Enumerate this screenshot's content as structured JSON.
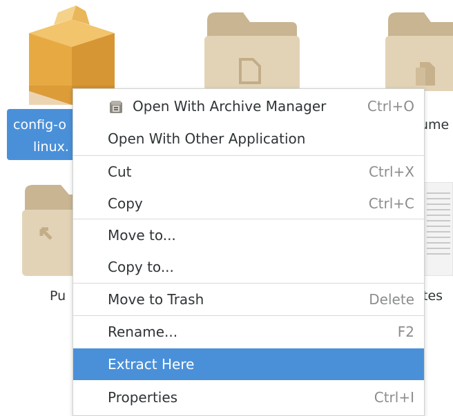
{
  "desktop": {
    "items": [
      {
        "name": "selected-item",
        "label_line1": "config-o",
        "label_line2": "linux."
      },
      {
        "name": "documents-folder",
        "label_partial": "ume"
      },
      {
        "name": "public-folder",
        "label_partial": "Pu"
      },
      {
        "name": "templates-folder",
        "label_partial": "tes"
      }
    ]
  },
  "context_menu": {
    "items": [
      {
        "label": "Open With Archive Manager",
        "shortcut": "Ctrl+O",
        "icon": "archive-manager-icon"
      },
      {
        "label": "Open With Other Application",
        "shortcut": ""
      },
      {
        "label": "Cut",
        "shortcut": "Ctrl+X"
      },
      {
        "label": "Copy",
        "shortcut": "Ctrl+C"
      },
      {
        "label": "Move to...",
        "shortcut": ""
      },
      {
        "label": "Copy to...",
        "shortcut": ""
      },
      {
        "label": "Move to Trash",
        "shortcut": "Delete"
      },
      {
        "label": "Rename...",
        "shortcut": "F2"
      },
      {
        "label": "Extract Here",
        "shortcut": "",
        "active": true
      },
      {
        "label": "Properties",
        "shortcut": "Ctrl+I"
      }
    ]
  },
  "colors": {
    "selection": "#4a90d9",
    "folder": "#d7c4a4",
    "package": "#e0a53c"
  }
}
